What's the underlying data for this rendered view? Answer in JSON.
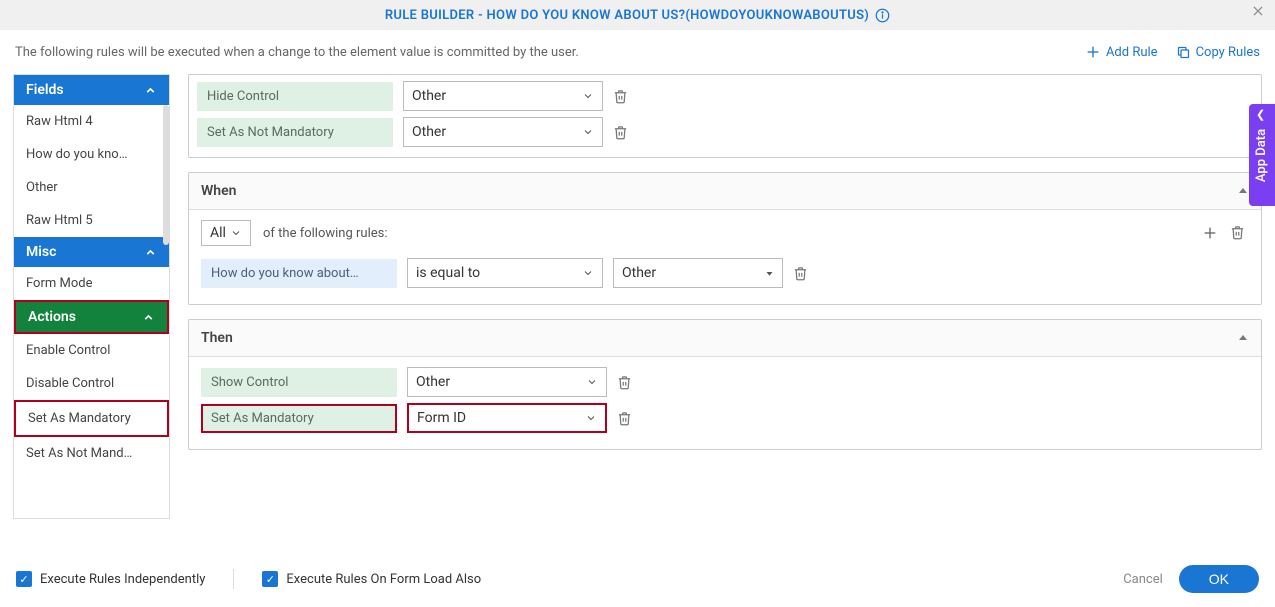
{
  "header": {
    "title": "RULE BUILDER - HOW DO YOU KNOW ABOUT US?(HOWDOYOUKNOWABOUTUS)"
  },
  "subheader": {
    "text": "The following rules will be executed when a change to the element value is committed by the user.",
    "addRule": "Add Rule",
    "copyRules": "Copy Rules"
  },
  "sidebar": {
    "fields": {
      "label": "Fields",
      "items": [
        "Raw Html 4",
        "How do you kno…",
        "Other",
        "Raw Html 5"
      ]
    },
    "misc": {
      "label": "Misc",
      "items": [
        "Form Mode"
      ]
    },
    "actions": {
      "label": "Actions",
      "items": [
        "Enable Control",
        "Disable Control",
        "Set As Mandatory",
        "Set As Not Mand…"
      ]
    }
  },
  "topCard": {
    "rows": [
      {
        "action": "Hide Control",
        "value": "Other"
      },
      {
        "action": "Set As Not Mandatory",
        "value": "Other"
      }
    ]
  },
  "when": {
    "title": "When",
    "scope": "All",
    "scopeText": "of the following rules:",
    "condition": {
      "field": "How do you know about…",
      "op": "is equal to",
      "value": "Other"
    }
  },
  "then": {
    "title": "Then",
    "rows": [
      {
        "action": "Show Control",
        "value": "Other",
        "boxed": false
      },
      {
        "action": "Set As Mandatory",
        "value": "Form ID",
        "boxed": true
      }
    ]
  },
  "footer": {
    "execIndependent": "Execute Rules Independently",
    "execOnLoad": "Execute Rules On Form Load Also",
    "cancel": "Cancel",
    "ok": "OK"
  },
  "appData": "App Data"
}
